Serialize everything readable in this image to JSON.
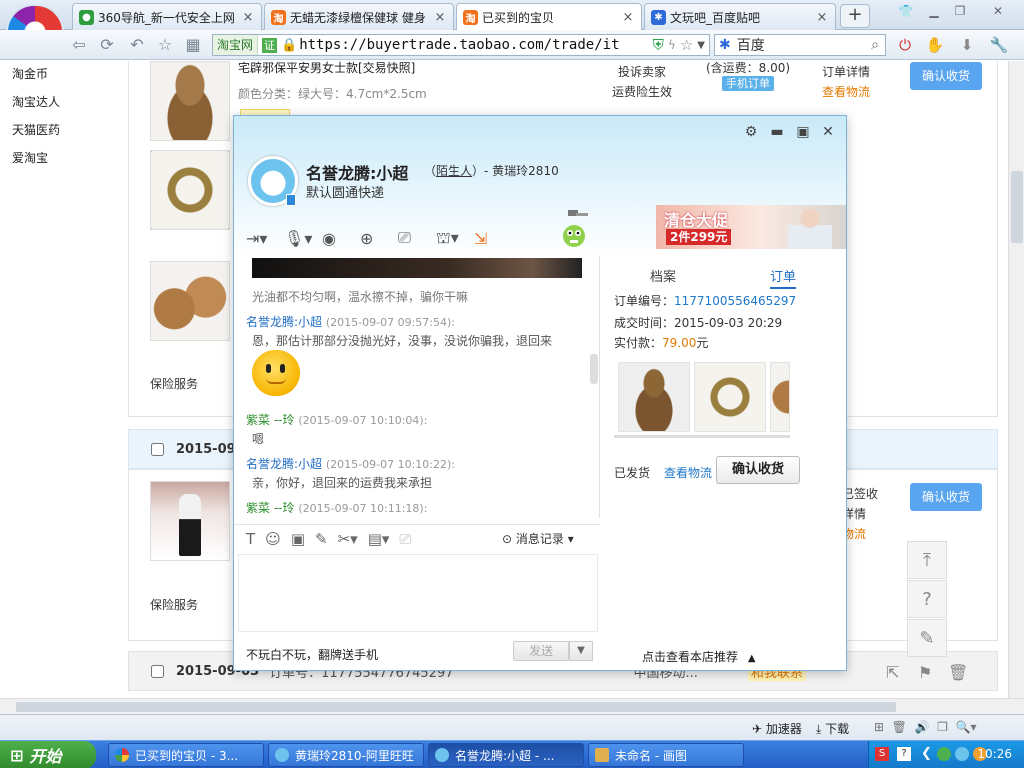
{
  "browser": {
    "tabs": [
      {
        "label": "360导航_新一代安全上网",
        "close": "×"
      },
      {
        "label": "无蜡无漆绿檀保健球 健身",
        "close": "×"
      },
      {
        "label": "已买到的宝贝",
        "close": "×"
      },
      {
        "label": "文玩吧_百度贴吧",
        "close": "×"
      }
    ],
    "new_tab": "+",
    "site_badge": "淘宝网",
    "cert_badge": "证",
    "url": "https://buyertrade.taobao.com/trade/it",
    "search_engine": "百度"
  },
  "left_nav": [
    "淘金币",
    "淘宝达人",
    "天猫医药",
    "爱淘宝"
  ],
  "order1": {
    "title_fragment": "宅辟邪保平安男女士款[交易快照]",
    "spec": "颜色分类：绿大号：4.7cm*2.5cm",
    "complain": "投诉卖家",
    "freight_insurance": "运费险生效",
    "shipping_fee": "(含运费：8.00)",
    "mobile_order": "手机订单",
    "order_detail": "订单详情",
    "view_logistics": "查看物流",
    "confirm": "确认收货",
    "service": "保险服务"
  },
  "order2": {
    "date": "2015-09-0",
    "confirm": "确认收货",
    "signed": "已签收",
    "detail": "详情",
    "logistics": "物流",
    "service": "保险服务"
  },
  "order3": {
    "date": "2015-09-03",
    "order_no": "订单号：1177554776745297",
    "seller_frag": "中国移动...",
    "contact": "和我联系"
  },
  "chat": {
    "name": "名誉龙腾:小超",
    "relation_prefix": "（",
    "relation": "陌生人",
    "relation_suffix": "）- 黄瑞玲2810",
    "signature": "默认圆通快递",
    "promo_title": "清仓大促",
    "promo_sub": "2件299元",
    "messages": [
      {
        "text": "光油都不均匀啊，温水擦不掉，骗你干嘛"
      },
      {
        "sender": "名誉龙腾:小超",
        "time": "(2015-09-07 09:57:54):",
        "text": "恩，那估计那部分没抛光好，没事，没说你骗我，退回来"
      },
      {
        "sender": "紫菜 --玲",
        "time": "(2015-09-07 10:10:04):",
        "text": "嗯"
      },
      {
        "sender": "名誉龙腾:小超",
        "time": "(2015-09-07 10:10:22):",
        "text": "亲，你好，退回来的运费我来承担"
      },
      {
        "sender": "紫菜 --玲",
        "time": "(2015-09-07 10:11:18):"
      }
    ],
    "history": "消息记录",
    "footer": "不玩白不玩，翻牌送手机",
    "send": "发送",
    "side": {
      "tab_profile": "档案",
      "tab_order": "订单",
      "order_no_label": "订单编号：",
      "order_no": "1177100556465297",
      "deal_time_label": "成交时间：",
      "deal_time": "2015-09-03 20:29",
      "paid_label": "实付款：",
      "paid": "79.00",
      "paid_unit": "元",
      "shipped": "已发货",
      "track": "查看物流",
      "confirm": "确认收货",
      "recommend": "点击查看本店推荐"
    }
  },
  "status_bar": {
    "accelerator": "加速器",
    "download": "下载"
  },
  "taskbar": {
    "start": "开始",
    "items": [
      "已买到的宝贝 - 3...",
      "黄瑞玲2810-阿里旺旺",
      "名誉龙腾:小超 - ...",
      "未命名 - 画图"
    ],
    "clock": "10:26"
  },
  "colors": {
    "accent_blue": "#5aa5ef",
    "link_blue": "#1f78c8",
    "price_orange": "#e27a00",
    "taskbar_blue": "#245ec6"
  }
}
